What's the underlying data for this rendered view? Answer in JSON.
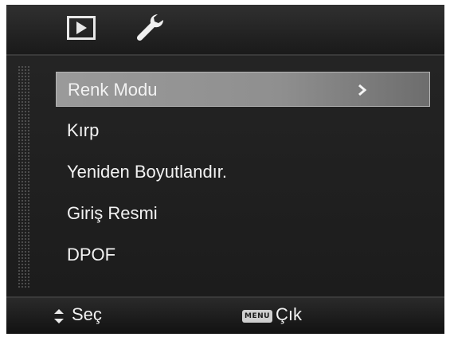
{
  "tabs": [
    {
      "name": "playback",
      "icon": "play-icon"
    },
    {
      "name": "setup",
      "icon": "wrench-icon"
    }
  ],
  "menu": {
    "items": [
      {
        "label": "Renk Modu",
        "selected": true
      },
      {
        "label": "Kırp"
      },
      {
        "label": "Yeniden Boyutlandır."
      },
      {
        "label": "Giriş Resmi"
      },
      {
        "label": "DPOF"
      }
    ]
  },
  "footer": {
    "select_label": "Seç",
    "menu_key_label": "MENU",
    "exit_label": "Çık"
  }
}
